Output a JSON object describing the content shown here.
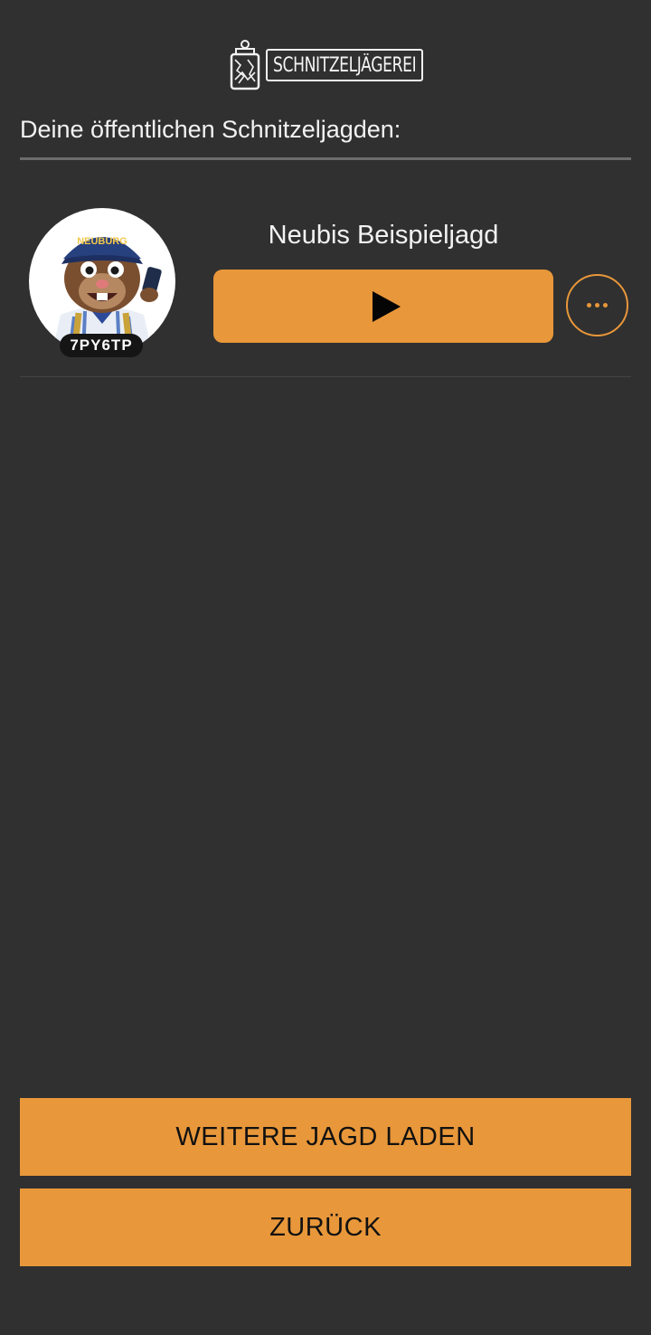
{
  "header": {
    "logo_text": "SCHNITZELJÄGEREI"
  },
  "section": {
    "title": "Deine öffentlichen Schnitzeljagden:"
  },
  "hunts": [
    {
      "name": "Neubis Beispieljagd",
      "code": "7PY6TP",
      "avatar_cap_text": "NEUBURG",
      "play_icon": "play-icon",
      "more_icon": "ellipsis-icon"
    }
  ],
  "actions": {
    "load_more_label": "WEITERE JAGD LADEN",
    "back_label": "ZURÜCK"
  },
  "colors": {
    "background": "#303030",
    "accent": "#e8973a",
    "text": "#f2f2f2"
  }
}
